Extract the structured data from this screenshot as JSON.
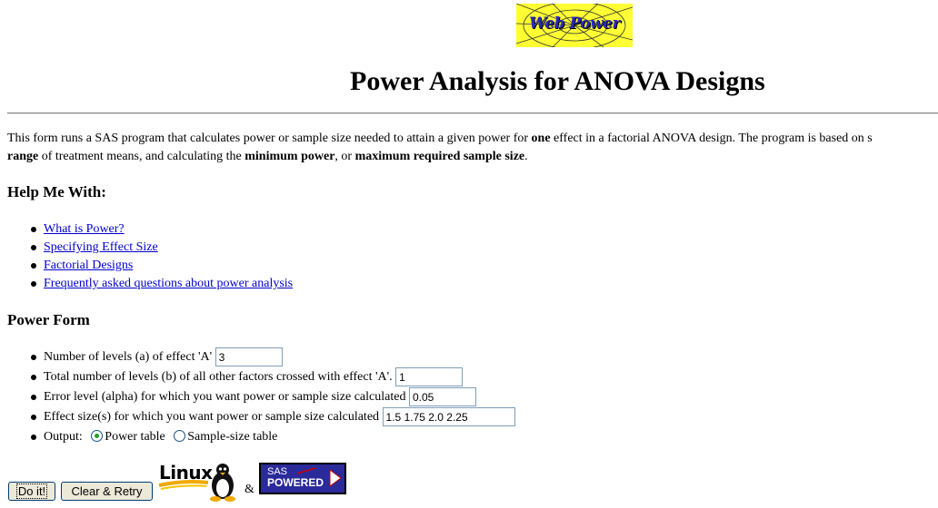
{
  "logo": {
    "text": "Web Power"
  },
  "page_title": "Power Analysis for ANOVA Designs",
  "intro": {
    "line1_a": "This form runs a SAS program that calculates power or sample size needed to attain a given power for ",
    "line1_bold": "one",
    "line1_b": " effect in a factorial ANOVA design. The program is based on s",
    "line2_bold1": "range",
    "line2_a": " of treatment means, and calculating the ",
    "line2_bold2": "minimum power",
    "line2_b": ", or ",
    "line2_bold3": "maximum required sample size",
    "line2_c": "."
  },
  "help": {
    "heading": "Help Me With:",
    "items": [
      {
        "label": "What is Power?"
      },
      {
        "label": "Specifying Effect Size"
      },
      {
        "label": "Factorial Designs"
      },
      {
        "label": "Frequently asked questions about power analysis"
      }
    ]
  },
  "power_form": {
    "heading": "Power Form",
    "levels_a": {
      "label": "Number of levels (a) of effect 'A'",
      "value": "3"
    },
    "levels_b": {
      "label": "Total number of levels (b) of all other factors crossed with effect 'A'.",
      "value": "1"
    },
    "alpha": {
      "label": "Error level (alpha) for which you want power or sample size calculated",
      "value": "0.05"
    },
    "effect_sizes": {
      "label": "Effect size(s) for which you want power or sample size calculated",
      "value": "1.5 1.75 2.0 2.25"
    },
    "output": {
      "label": "Output:",
      "options": [
        "Power table",
        "Sample-size table"
      ],
      "selected": "Power table"
    }
  },
  "buttons": {
    "do_it": "Do it!",
    "clear_retry": "Clear & Retry"
  },
  "footer": {
    "linux_logo": "Linux",
    "ampersand": "&",
    "sas_logo_line1": "SAS",
    "sas_logo_line2": "POWERED"
  },
  "colors": {
    "link": "#0000cc",
    "logo_bg": "#ffff33",
    "sas_bg": "#2a2a9a"
  }
}
